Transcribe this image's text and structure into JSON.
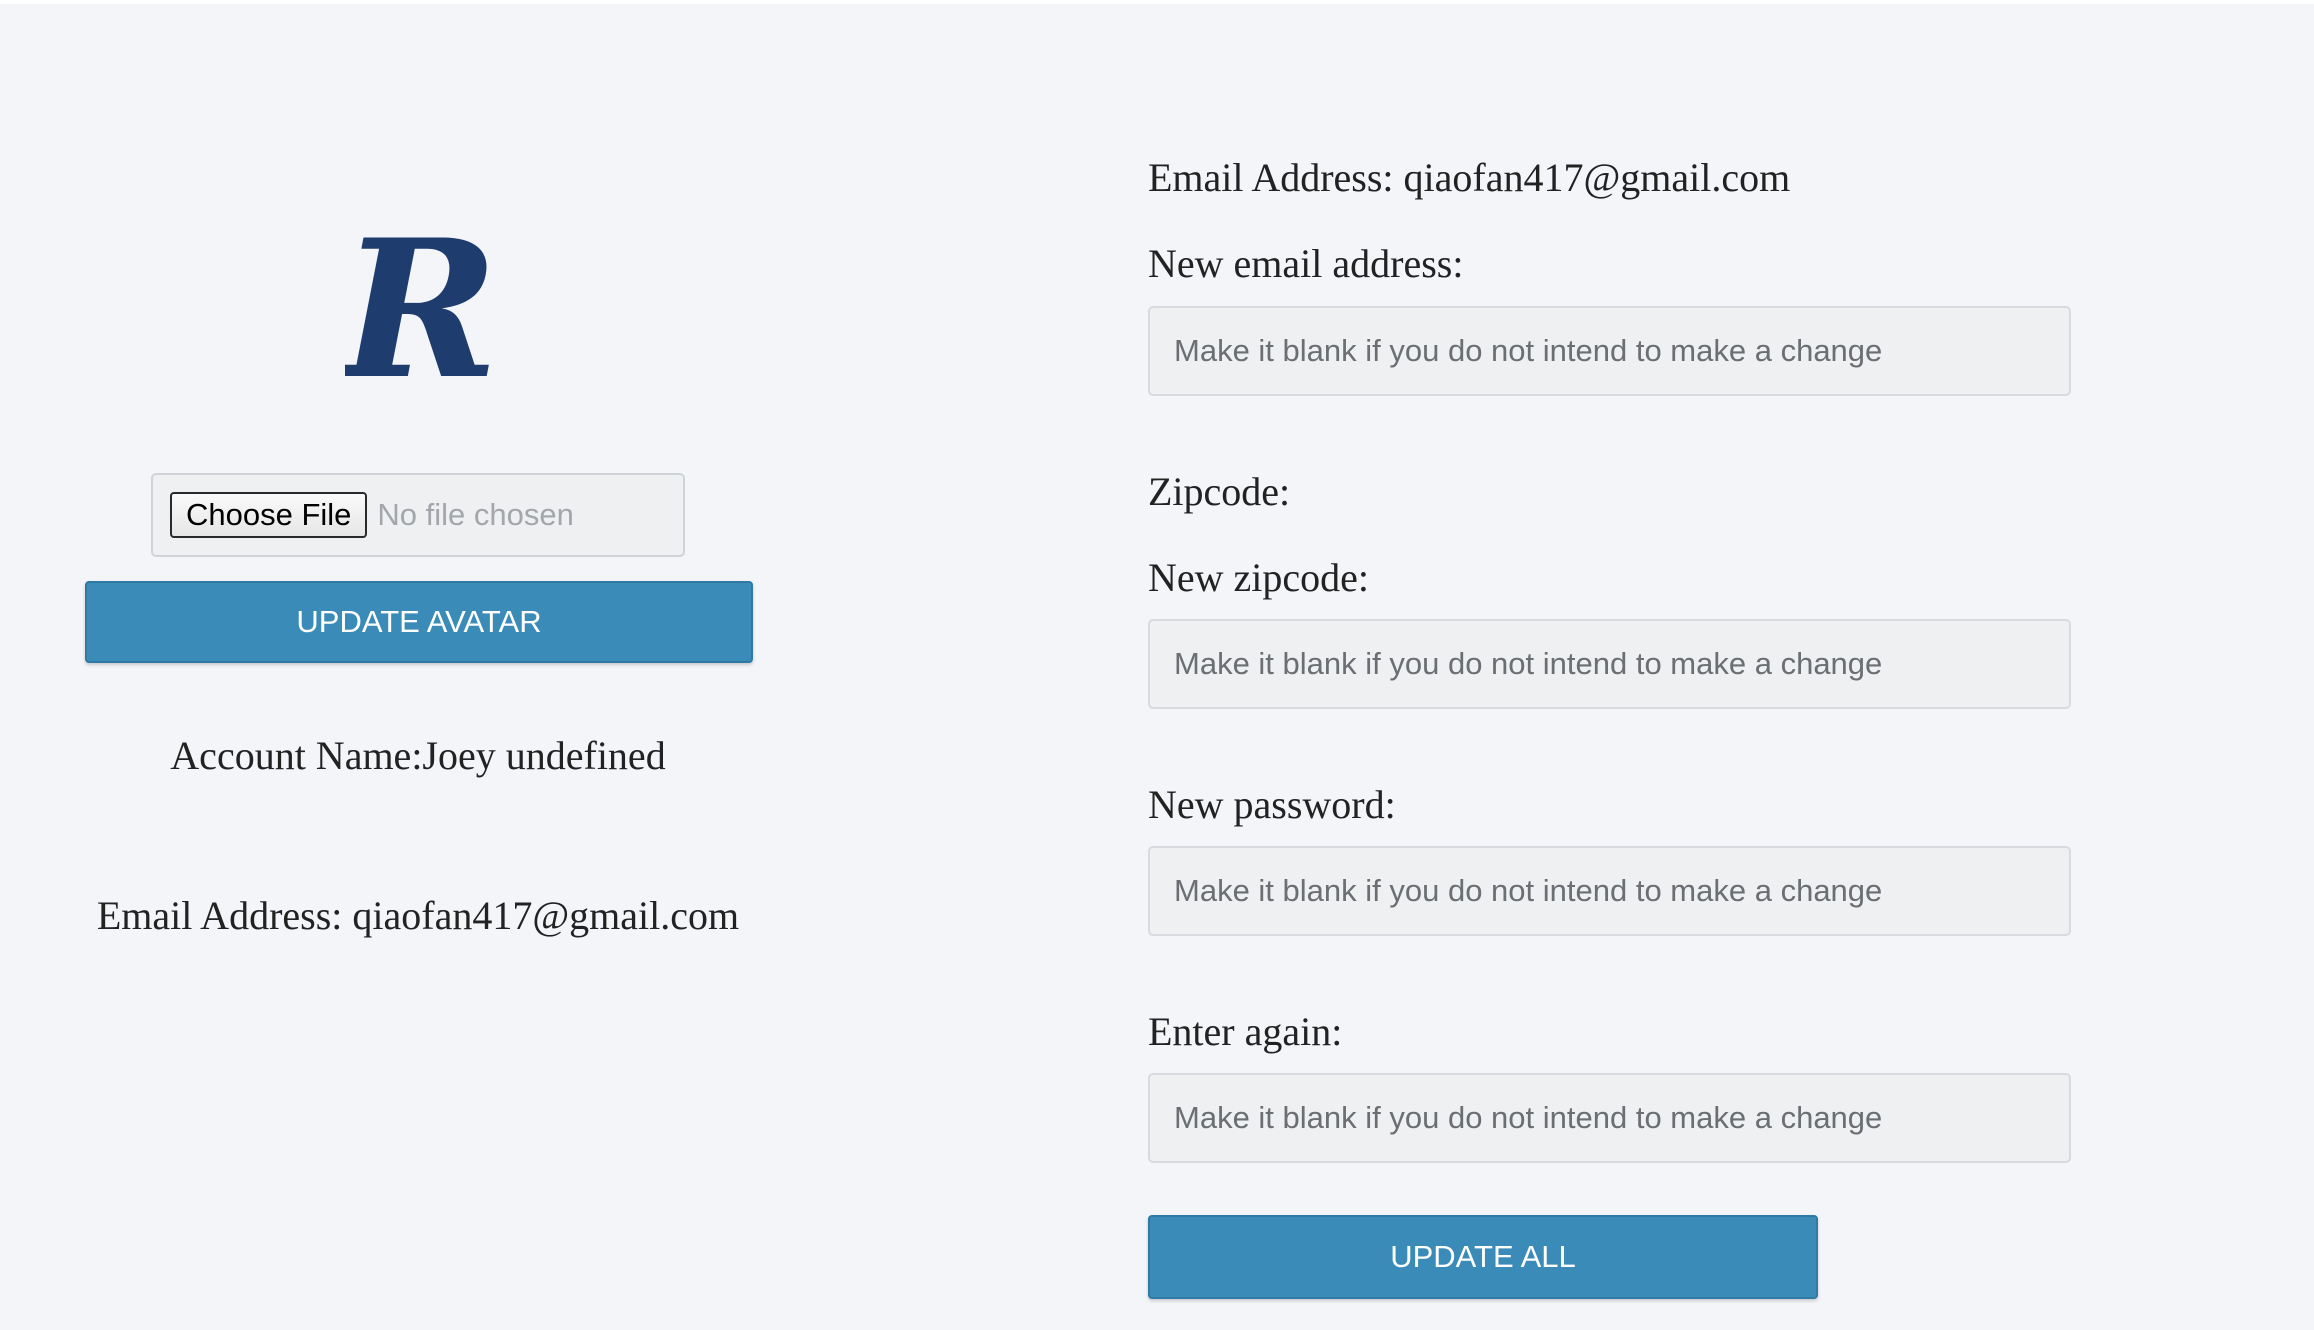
{
  "profile": {
    "avatar_icon": "rice-owl-r-logo-icon",
    "file_input": {
      "button_label": "Choose File",
      "status_text": "No file chosen"
    },
    "update_avatar_label": "UPDATE AVATAR",
    "account_name_text": "Account Name:Joey undefined",
    "email_text": "Email Address: qiaofan417@gmail.com"
  },
  "form": {
    "current_email_text": "Email Address: qiaofan417@gmail.com",
    "new_email_label": "New email address:",
    "new_email_placeholder": "Make it blank if you do not intend to make a change",
    "zipcode_label": "Zipcode:",
    "new_zipcode_label": "New zipcode:",
    "new_zipcode_placeholder": "Make it blank if you do not intend to make a change",
    "new_password_label": "New password:",
    "new_password_placeholder": "Make it blank if you do not intend to make a change",
    "enter_again_label": "Enter again:",
    "enter_again_placeholder": "Make it blank if you do not intend to make a change",
    "update_all_label": "UPDATE ALL"
  },
  "colors": {
    "page_background": "#f3f5f9",
    "button_primary": "#3b8bb8",
    "logo_navy": "#1f3c6e"
  }
}
